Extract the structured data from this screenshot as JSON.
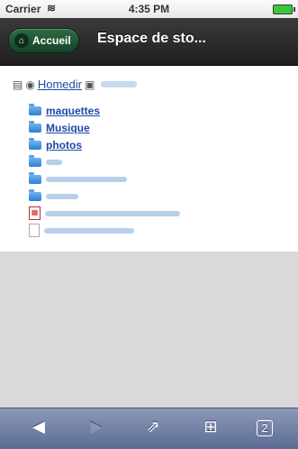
{
  "status_bar": {
    "carrier": "Carrier",
    "time": "4:35 PM",
    "wifi_icon": "wifi-icon",
    "battery_icon": "battery-icon"
  },
  "nav": {
    "back_label": "Accueil",
    "title": "Espace de sto..."
  },
  "breadcrumb": {
    "label": "Homedir"
  },
  "files": [
    {
      "type": "folder",
      "name": "maquettes"
    },
    {
      "type": "folder",
      "name": "Musique"
    },
    {
      "type": "folder",
      "name": "photos"
    },
    {
      "type": "folder",
      "name": ""
    },
    {
      "type": "folder",
      "name": ""
    },
    {
      "type": "folder",
      "name": ""
    },
    {
      "type": "pdf",
      "name": ""
    },
    {
      "type": "doc",
      "name": ""
    }
  ],
  "toolbar": {
    "back_icon": "back-arrow-icon",
    "forward_icon": "forward-arrow-icon",
    "share_icon": "share-icon",
    "bookmarks_icon": "bookmarks-icon",
    "tabs_icon": "tabs-icon",
    "tabs_count": "2"
  }
}
